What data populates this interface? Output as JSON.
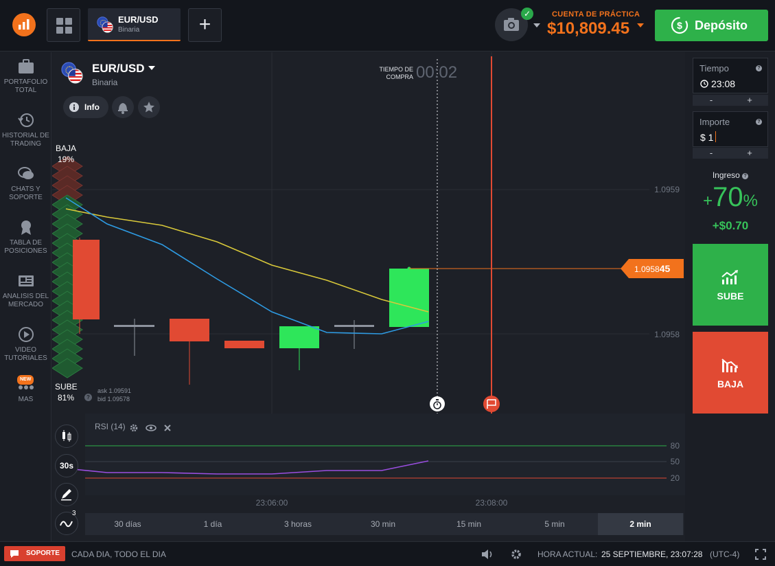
{
  "header": {
    "asset_tab": {
      "name": "EUR/USD",
      "type": "Binaria"
    },
    "account_label": "CUENTA DE PRÁCTICA",
    "balance": "$10,809.45",
    "deposit_label": "Depósito"
  },
  "sidebar": {
    "items": [
      {
        "icon": "briefcase-icon",
        "label": "PORTAFOLIO TOTAL"
      },
      {
        "icon": "history-icon",
        "label": "HISTORIAL DE TRADING"
      },
      {
        "icon": "chat-icon",
        "label": "CHATS Y SOPORTE"
      },
      {
        "icon": "medal-icon",
        "label": "TABLA DE POSICIONES"
      },
      {
        "icon": "newspaper-icon",
        "label": "ANALISIS DEL MERCADO"
      },
      {
        "icon": "play-icon",
        "label": "VIDEO TUTORIALES"
      },
      {
        "icon": "more-dots-icon",
        "label": "MAS",
        "badge": "NEW"
      }
    ]
  },
  "chart_panel": {
    "asset_name": "EUR/USD",
    "asset_type": "Binaria",
    "info_label": "Info",
    "timer_label": "TIEMPO DE COMPRA",
    "timer_value": "00:02",
    "baja_label": "BAJA",
    "baja_pct": "19%",
    "sube_label": "SUBE",
    "sube_pct": "81%",
    "ask": "ask 1.09591",
    "bid": "bid 1.09578",
    "price_tag": "1.0958",
    "price_tag_bold": "45",
    "rsi_label": "RSI (14)",
    "timeframe_btn": "30s",
    "indicator_count": "3",
    "time_ranges": [
      "30 días",
      "1 día",
      "3 horas",
      "30 min",
      "15 min",
      "5 min",
      "2 min"
    ],
    "active_range": "2 min"
  },
  "chart_data": {
    "type": "candlestick",
    "price_axis_labels": [
      "1.0959",
      "1.0958"
    ],
    "rsi_axis_labels": [
      "80",
      "50",
      "20"
    ],
    "time_labels": [
      "23:06:00",
      "23:08:00"
    ],
    "colors": {
      "up": "#2ee65a",
      "down": "#e14a33",
      "ma_fast": "#2e9be3",
      "ma_slow": "#d9c93a",
      "rsi": "#9a4ee0",
      "expiry": "#e14a33",
      "price_line": "#f2721c"
    },
    "candles": [
      {
        "dir": "down",
        "open": 1.09588,
        "close": 1.0958
      },
      {
        "dir": "flat",
        "open": 1.09579,
        "close": 1.09579
      },
      {
        "dir": "down",
        "open": 1.0958,
        "close": 1.09578
      },
      {
        "dir": "down",
        "open": 1.09577,
        "close": 1.09577
      },
      {
        "dir": "up",
        "open": 1.09577,
        "close": 1.09579
      },
      {
        "dir": "flat",
        "open": 1.09579,
        "close": 1.09579
      },
      {
        "dir": "up",
        "open": 1.09579,
        "close": 1.09584
      }
    ]
  },
  "trade_panel": {
    "time_label": "Tiempo",
    "time_value": "23:08",
    "amount_label": "Importe",
    "amount_value": "$ 1",
    "stepper_minus": "-",
    "stepper_plus": "+",
    "income_label": "Ingreso",
    "income_pct_sign": "+",
    "income_pct_value": "70",
    "income_pct_unit": "%",
    "income_amount": "+$0.70",
    "call_label": "SUBE",
    "put_label": "BAJA"
  },
  "footer": {
    "support_label": "SOPORTE",
    "support_hours": "CADA DIA, TODO EL DIA",
    "time_label": "HORA ACTUAL:",
    "time_value": "25 SEPTIEMBRE, 23:07:28",
    "timezone": "(UTC-4)"
  }
}
